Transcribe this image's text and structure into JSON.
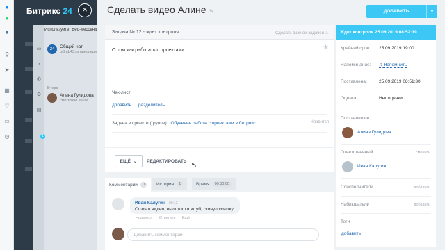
{
  "app": {
    "logo_main": "Битрикс",
    "logo_num": "24"
  },
  "close_symbol": "×",
  "notifications": {
    "header": "Используйте \"Веб-мессенджер\"",
    "items": [
      {
        "title": "Общий чат",
        "subtitle": "b@ab43.ru присоединился",
        "avatar_color": "#2067b0",
        "avatar_text": "24"
      },
      {
        "title": "Алина Гулидова",
        "subtitle": "Это точно ваше",
        "avatar_color": "#7a5a48",
        "avatar_text": ""
      }
    ],
    "date_label": "Вчера",
    "badge": "1"
  },
  "task": {
    "title": "Сделать видео Алине",
    "add_button": "ДОБАВИТЬ",
    "header": "Задача № 12 - ждет контроля",
    "mark_important": "Сделать важной задачей",
    "description": "О том как работать с проектами",
    "checklist_label": "Чек-лист",
    "checklist_add": "добавить",
    "checklist_separator": "разделитель",
    "project_label": "Задача в проекте (группе):",
    "project_link": "Обучение работе с проектами в битрикс",
    "likes": "Нравится",
    "more_button": "ЕЩЁ",
    "edit_button": "РЕДАКТИРОВАТЬ"
  },
  "comments": {
    "tabs": [
      {
        "label": "Комментарии",
        "count": "0"
      },
      {
        "label": "История",
        "count": "1"
      },
      {
        "label": "Время",
        "count": "00:00:00"
      }
    ],
    "items": [
      {
        "author": "Иван Калугин",
        "time": "00:12",
        "text": "Создал видео, выложил в ютуб, скинул ссылку",
        "actions": [
          "Нравится",
          "Ответить",
          "Ещё"
        ]
      }
    ],
    "input_placeholder": "Добавить комментарий"
  },
  "sidebar": {
    "status": "Ждет контроля 25.09.2019 08:52:19",
    "deadline_label": "Крайний срок:",
    "deadline_value": "25.09.2019 19:00",
    "reminder_label": "Напоминание:",
    "reminder_value": "Напомнить",
    "created_label": "Поставлена:",
    "created_value": "25.09.2019 08:51:30",
    "rating_label": "Оценка:",
    "rating_value": "Нет оценки",
    "creator_label": "Постановщик",
    "creator_name": "Алина Гулидова",
    "responsible_label": "Ответственный",
    "responsible_action": "сменить",
    "responsible_name": "Иван Калугин",
    "coexec_label": "Соисполнители",
    "coexec_action": "добавить",
    "observers_label": "Наблюдатели",
    "observers_action": "добавить",
    "tags_label": "Теги",
    "tags_action": "добавить"
  },
  "colors": {
    "accent": "#3bc8f5",
    "link": "#2067b0",
    "dark_sidebar": "#2c3b47"
  }
}
